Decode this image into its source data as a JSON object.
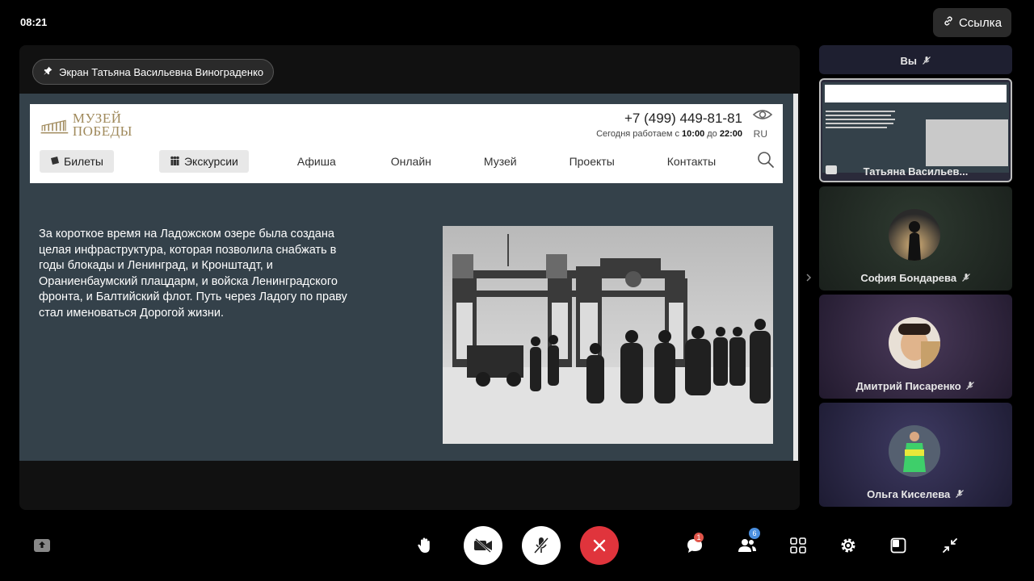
{
  "status": {
    "time": "08:21"
  },
  "top_right": {
    "link_label": "Ссылка"
  },
  "stage": {
    "pinned_label": "Экран Татьяна Васильевна Винограденко"
  },
  "site": {
    "logo_line1": "МУЗЕЙ",
    "logo_line2": "ПОБЕДЫ",
    "phone": "+7 (499) 449-81-81",
    "hours_prefix": "Сегодня работаем с",
    "hours_open": "10:00",
    "hours_mid": "до",
    "hours_close": "22:00",
    "lang": "RU",
    "nav": {
      "tickets": "Билеты",
      "excursions": "Экскурсии",
      "afisha": "Афиша",
      "online": "Онлайн",
      "museum": "Музей",
      "projects": "Проекты",
      "contacts": "Контакты"
    },
    "body_text": "За короткое время на Ладожском озере была создана целая инфраструктура, которая позволила снабжать в годы блокады и Ленинград, и Кронштадт, и Ораниенбаумский плацдарм, и войска Ленинградского фронта, и Балтийский флот. Путь через Ладогу по праву стал именоваться Дорогой жизни."
  },
  "participants": [
    {
      "name": "Вы"
    },
    {
      "name": "Татьяна Васильев..."
    },
    {
      "name": "София Бондарева"
    },
    {
      "name": "Дмитрий Писаренко"
    },
    {
      "name": "Ольга Киселева"
    }
  ],
  "toolbar": {
    "chat_badge": "1",
    "participants_badge": "6"
  },
  "colors": {
    "end_call": "#e0343c",
    "chat_badge": "#e0554a",
    "participants_badge": "#4a8fe0",
    "shared_bg": "#34414a",
    "museum_gold": "#a08a5c"
  }
}
